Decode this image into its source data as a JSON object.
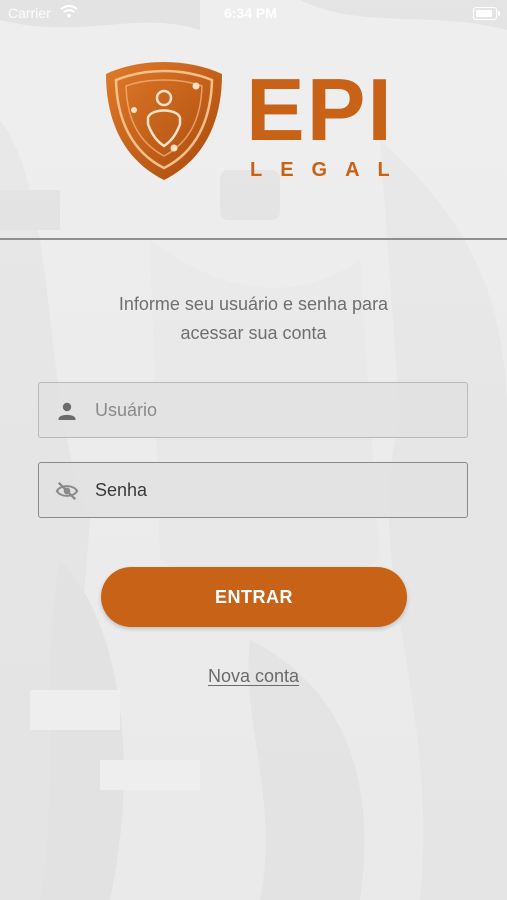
{
  "status_bar": {
    "carrier": "Carrier",
    "time": "6:34 PM",
    "wifi_icon": "wifi-icon",
    "battery_icon": "battery-icon"
  },
  "logo": {
    "brand": "EPI",
    "subtitle": "LEGAL",
    "icon": "shield-user-icon"
  },
  "colors": {
    "accent": "#c86217",
    "background": "#e9e9e9",
    "divider": "#8f8f8f",
    "text_muted": "#6f6f6f"
  },
  "instructions": {
    "line1": "Informe seu usuário e senha para",
    "line2": "acessar sua conta"
  },
  "form": {
    "username": {
      "placeholder": "Usuário",
      "value": "",
      "icon": "person-icon"
    },
    "password": {
      "placeholder": "Senha",
      "value": "",
      "icon": "eye-off-icon"
    },
    "submit_label": "ENTRAR"
  },
  "links": {
    "new_account": "Nova conta"
  }
}
